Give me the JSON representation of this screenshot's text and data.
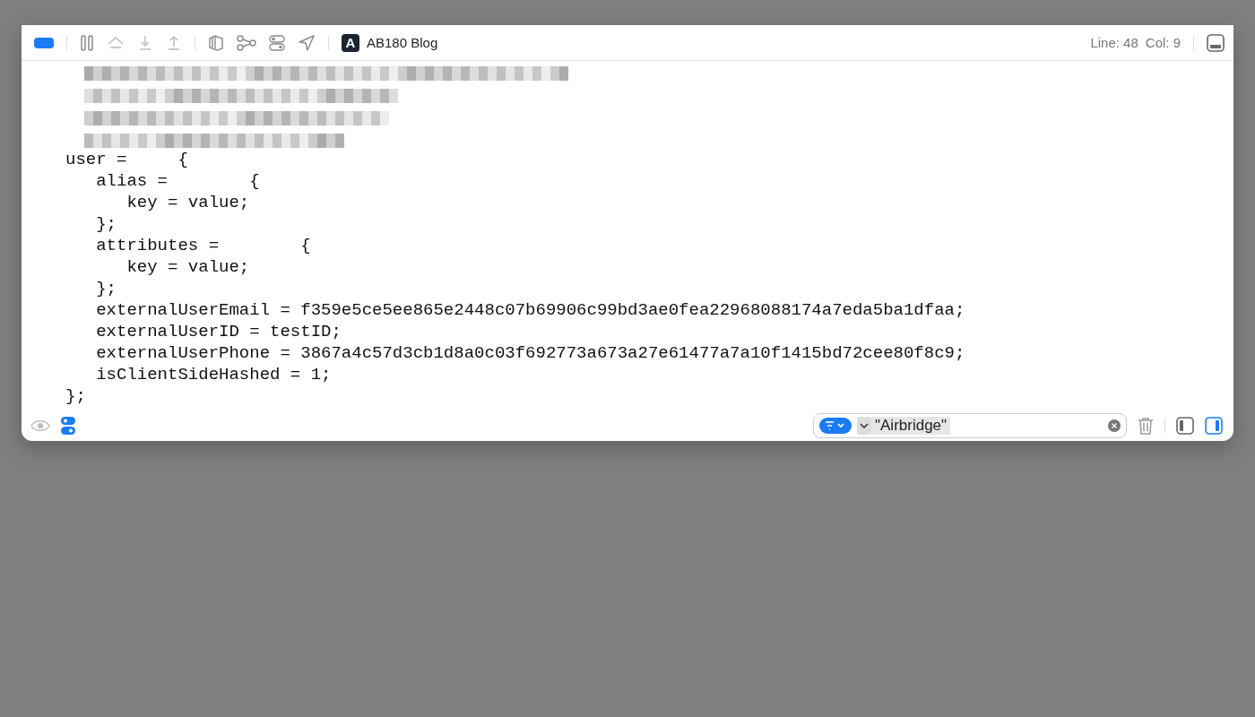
{
  "toolbar": {
    "app_name": "AB180 Blog",
    "app_badge": "A",
    "status": {
      "line": "Line: 48",
      "col": "Col: 9"
    }
  },
  "console": {
    "lines": [
      "user =     {",
      "   alias =        {",
      "      key = value;",
      "   };",
      "   attributes =        {",
      "      key = value;",
      "   };",
      "   externalUserEmail = f359e5ce5ee865e2448c07b69906c99bd3ae0fea22968088174a7eda5ba1dfaa;",
      "   externalUserID = testID;",
      "   externalUserPhone = 3867a4c57d3cb1d8a0c03f692773a673a27e61477a7a10f1415bd72cee80f8c9;",
      "   isClientSideHashed = 1;",
      "};"
    ]
  },
  "bottom_bar": {
    "filter": {
      "value": "\"Airbridge\""
    },
    "left_panel_on": false,
    "right_panel_on": true
  }
}
